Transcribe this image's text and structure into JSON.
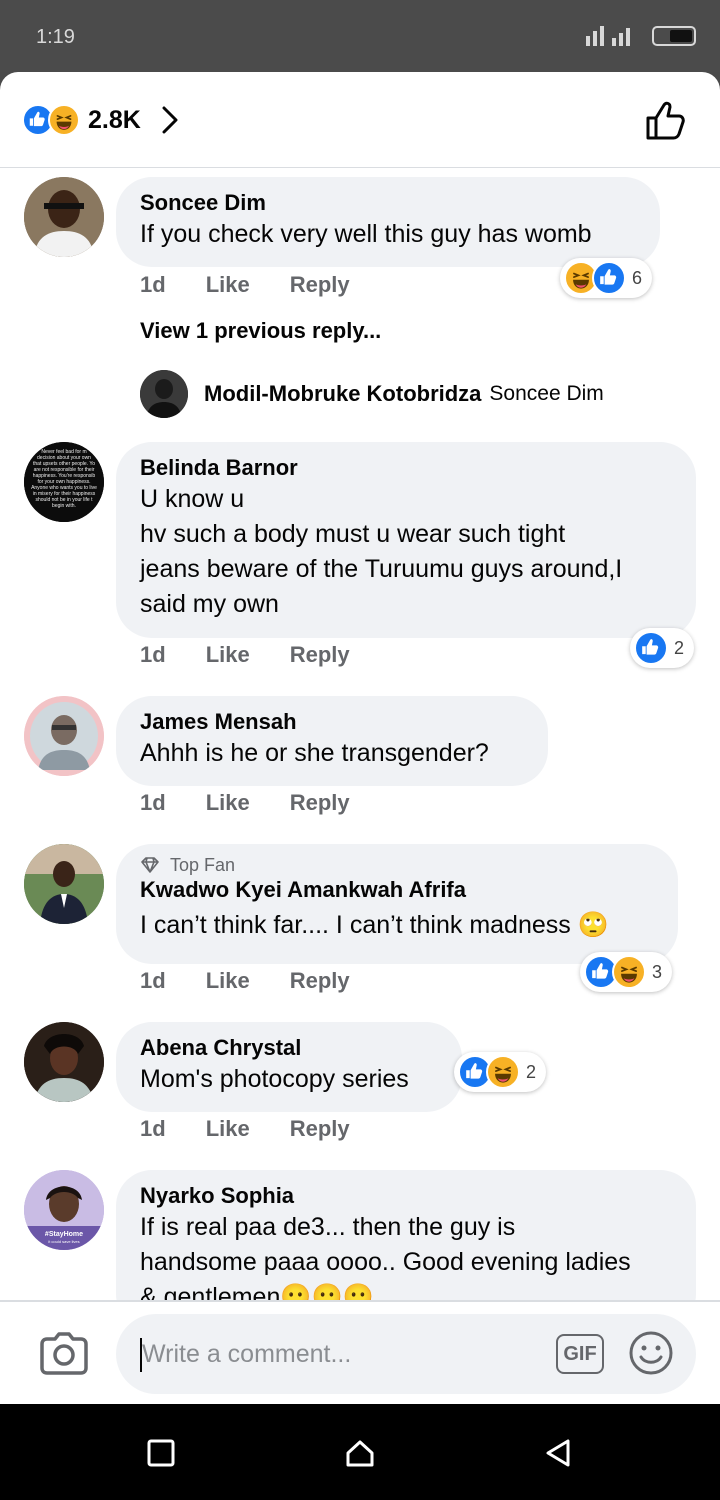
{
  "status_bar": {
    "time": "1:19"
  },
  "header": {
    "reaction_count": "2.8K"
  },
  "comments": [
    {
      "name": "Soncee Dim",
      "text": [
        "If you check very well this guy has womb"
      ],
      "time": "1d",
      "like": "Like",
      "reply": "Reply",
      "reactions": [
        "haha",
        "like"
      ],
      "reaction_count": "6"
    },
    {
      "name": "Belinda Barnor",
      "text": [
        "U know u",
        "hv such a body must u wear such tight",
        "jeans beware of the Turuumu guys around,I",
        "said my own"
      ],
      "time": "1d",
      "like": "Like",
      "reply": "Reply",
      "reactions": [
        "like"
      ],
      "reaction_count": "2"
    },
    {
      "name": "James Mensah",
      "text": [
        "Ahhh is he or she transgender?"
      ],
      "time": "1d",
      "like": "Like",
      "reply": "Reply"
    },
    {
      "badge": "Top Fan",
      "name": "Kwadwo Kyei Amankwah Afrifa",
      "text": [
        "I can’t think far.... I can’t think madness 🙄"
      ],
      "time": "1d",
      "like": "Like",
      "reply": "Reply",
      "reactions": [
        "like",
        "haha"
      ],
      "reaction_count": "3"
    },
    {
      "name": "Abena Chrystal",
      "text": [
        "Mom's photocopy series"
      ],
      "time": "1d",
      "like": "Like",
      "reply": "Reply",
      "reactions": [
        "like",
        "haha"
      ],
      "reaction_count": "2"
    },
    {
      "name": "Nyarko Sophia",
      "text": [
        "If is real paa de3... then the guy is",
        "handsome paaa oooo.. Good evening ladies",
        "& gentlemen😶😶😶"
      ]
    }
  ],
  "replies": {
    "view_previous": "View 1 previous reply...",
    "reply_author": "Modil-Mobruke Kotobridza",
    "reply_tag": "Soncee Dim"
  },
  "avatar_texts": {
    "belinda": [
      "Never feel bad for m",
      "decision about your own",
      "that upsets other people. Yo",
      "are not responsible for their",
      "happiness. You're responsib",
      "for your own happiness.",
      "Anyone who wants you to live",
      "in misery for their happiness",
      "should not be in your life t",
      "begin with."
    ],
    "sophia": [
      "#StayHome",
      "it could save lives"
    ]
  },
  "composer": {
    "placeholder": "Write a comment...",
    "gif_label": "GIF"
  },
  "colors": {
    "like": "#1877f2",
    "haha": "#f7b125",
    "bubble": "#f0f2f5",
    "secondary_text": "#65676b"
  },
  "icons": [
    "like-reaction-icon",
    "haha-reaction-icon",
    "chevron-right-icon",
    "thumbs-up-outline-icon",
    "camera-icon",
    "smiley-icon",
    "diamond-icon",
    "nav-square-icon",
    "nav-circle-icon",
    "nav-back-icon"
  ]
}
